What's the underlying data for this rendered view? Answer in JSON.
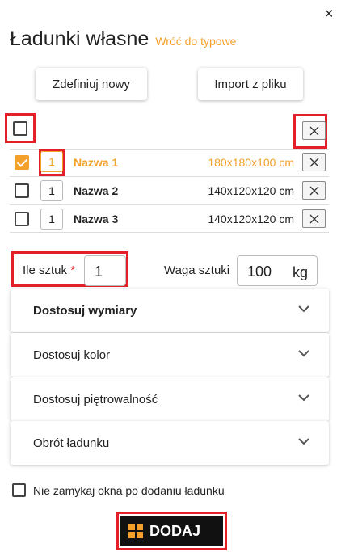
{
  "dialog": {
    "title": "Ładunki własne",
    "back_link": "Wróć do typowe",
    "close_symbol": "×"
  },
  "buttons": {
    "define_new": "Zdefiniuj nowy",
    "import_file": "Import z pliku"
  },
  "cargo_list": [
    {
      "qty": "1",
      "name": "Nazwa 1",
      "dims": "180x180x100 cm",
      "checked": true
    },
    {
      "qty": "1",
      "name": "Nazwa 2",
      "dims": "140x120x120 cm",
      "checked": false
    },
    {
      "qty": "1",
      "name": "Nazwa 3",
      "dims": "140x120x120 cm",
      "checked": false
    }
  ],
  "form": {
    "quantity_label": "Ile sztuk",
    "required_mark": "*",
    "quantity_value": "1",
    "weight_label": "Waga sztuki",
    "weight_value": "100",
    "weight_unit": "kg"
  },
  "accordions": [
    {
      "label": "Dostosuj wymiary"
    },
    {
      "label": "Dostosuj kolor"
    },
    {
      "label": "Dostosuj piętrowalność"
    },
    {
      "label": "Obrót ładunku"
    }
  ],
  "keep_open_label": "Nie zamykaj okna po dodaniu ładunku",
  "add_button": "DODAJ",
  "colors": {
    "accent": "#f3a12b",
    "highlight": "#e3202a",
    "add_button_bg": "#111111"
  }
}
